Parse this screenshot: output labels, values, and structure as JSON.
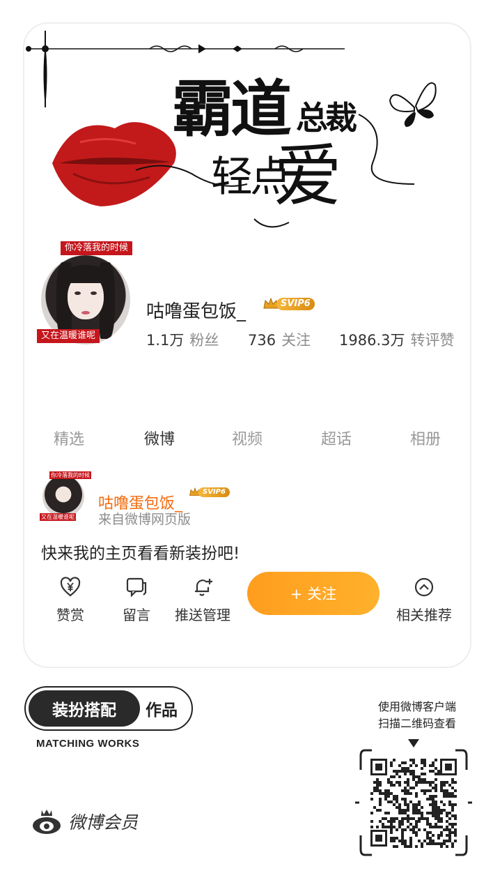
{
  "banner": {
    "title_line1_big": "霸道",
    "title_line1_small": "总裁",
    "title_line2_small": "轻点",
    "title_line2_big": "爱"
  },
  "profile": {
    "avatar_tag_top": "你冷落我的时候",
    "avatar_tag_bottom": "又在温暖谁呢",
    "username": "咕噜蛋包饭_",
    "vip_badge": "SVIP6",
    "stats": [
      {
        "value": "1.1万",
        "label": "粉丝"
      },
      {
        "value": "736",
        "label": "关注"
      },
      {
        "value": "1986.3万",
        "label": "转评赞"
      }
    ]
  },
  "tabs": [
    {
      "label": "精选",
      "active": false
    },
    {
      "label": "微博",
      "active": true
    },
    {
      "label": "视频",
      "active": false
    },
    {
      "label": "超话",
      "active": false
    },
    {
      "label": "相册",
      "active": false
    }
  ],
  "post": {
    "mini_tag_top": "你冷落我的时候",
    "mini_tag_bottom": "又在温暖谁呢",
    "username": "咕噜蛋包饭_",
    "vip_badge": "SVIP6",
    "source": "来自微博网页版",
    "text": "快来我的主页看看新装扮吧!"
  },
  "actions": {
    "reward": "赞赏",
    "comment": "留言",
    "push": "推送管理",
    "follow": "+ 关注",
    "recommend": "相关推荐"
  },
  "footer": {
    "badge_dark": "装扮搭配",
    "badge_light": "作品",
    "badge_sub": "MATCHING WORKS",
    "brand": "微博会员",
    "qr_line1": "使用微博客户端",
    "qr_line2": "扫描二维码查看"
  },
  "colors": {
    "accent_orange": "#f26b0f",
    "follow_gradient": [
      "#ff9d1e",
      "#ffb12c"
    ],
    "tag_red": "#c5161c",
    "vip_gold": "#e8a020"
  }
}
